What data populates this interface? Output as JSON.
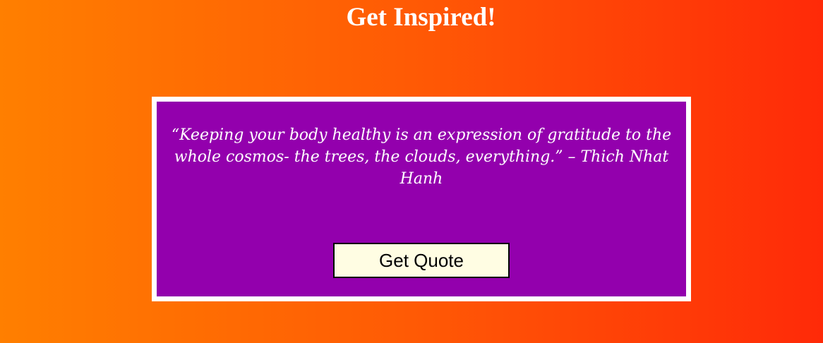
{
  "page": {
    "title": "Get Inspired!"
  },
  "quote": {
    "text": "“Keeping your body healthy is an expression of gratitude to the whole cosmos- the trees, the clouds, everything.” – Thich Nhat Hanh"
  },
  "controls": {
    "get_quote_label": "Get Quote"
  },
  "colors": {
    "background_left": "#ff7f00",
    "background_right": "#ff2a08",
    "card_background": "#9300ad",
    "card_border": "#ffffff",
    "button_background": "#fffde3"
  }
}
